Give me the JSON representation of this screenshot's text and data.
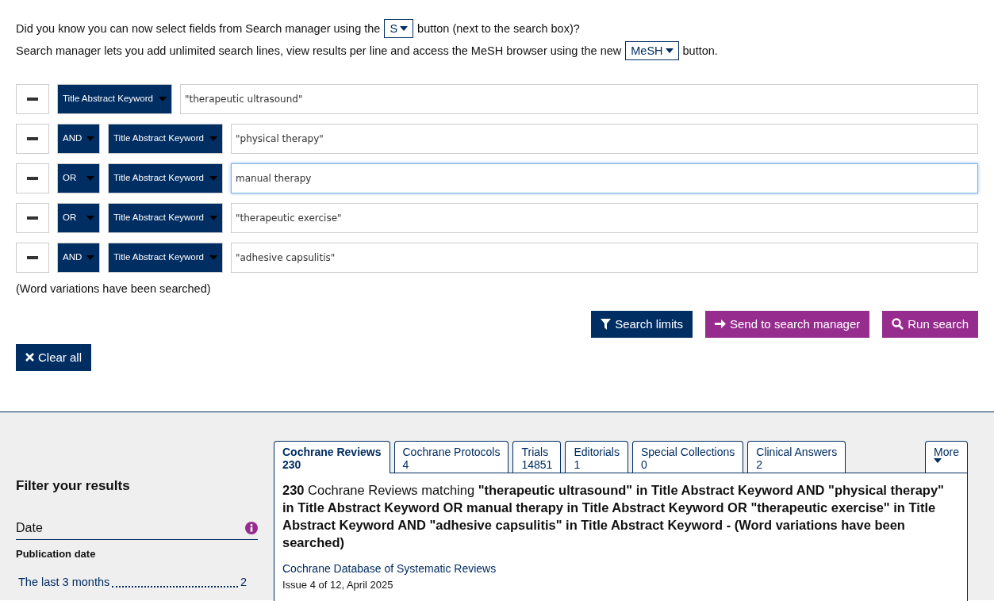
{
  "tips": [
    {
      "before": "Did you know you can now select fields from Search manager using the",
      "button": "S",
      "after": "button (next to the search box)?"
    },
    {
      "before": "Search manager lets you add unlimited search lines, view results per line and access the MeSH browser using the new",
      "button": "MeSH",
      "after": "button."
    }
  ],
  "search_lines": [
    {
      "field": "Title Abstract Keyword",
      "value": "\"therapeutic ultrasound\"",
      "focused": false
    },
    {
      "operator": "AND",
      "field": "Title Abstract Keyword",
      "value": "\"physical therapy\"",
      "focused": false
    },
    {
      "operator": "OR",
      "field": "Title Abstract Keyword",
      "value": "manual therapy",
      "focused": true
    },
    {
      "operator": "OR",
      "field": "Title Abstract Keyword",
      "value": "\"therapeutic exercise\"",
      "focused": false
    },
    {
      "operator": "AND",
      "field": "Title Abstract Keyword",
      "value": "\"adhesive capsulitis\"",
      "focused": false
    }
  ],
  "note": "(Word variations have been searched)",
  "actions": [
    {
      "label": "Search limits",
      "kind": "filter"
    },
    {
      "label": "Send to search manager",
      "kind": "send"
    },
    {
      "label": "Run search",
      "kind": "search"
    }
  ],
  "clear_all": "Clear all",
  "filter": {
    "title": "Filter your results",
    "section": "Date",
    "subsection": "Publication date",
    "items": [
      {
        "label": "The last 3 months",
        "count": "2"
      }
    ]
  },
  "tabs": [
    {
      "label": "Cochrane Reviews",
      "count": "230",
      "selected": true
    },
    {
      "label": "Cochrane Protocols",
      "count": "4",
      "selected": false
    },
    {
      "label": "Trials",
      "count": "14851",
      "selected": false
    },
    {
      "label": "Editorials",
      "count": "1",
      "selected": false
    },
    {
      "label": "Special Collections",
      "count": "0",
      "selected": false
    },
    {
      "label": "Clinical Answers",
      "count": "2",
      "selected": false
    }
  ],
  "more": "More",
  "result": {
    "heading": "**230** Cochrane Reviews matching **\"therapeutic ultrasound\" in Title Abstract Keyword AND \"physical therapy\" in Title Abstract Keyword OR manual therapy in Title Abstract Keyword OR \"therapeutic exercise\" in Title Abstract Keyword AND \"adhesive capsulitis\" in Title Abstract Keyword - (Word variations have been searched)**",
    "source": "Cochrane Database of Systematic Reviews",
    "issue": "Issue 4 of 12, April 2025"
  }
}
